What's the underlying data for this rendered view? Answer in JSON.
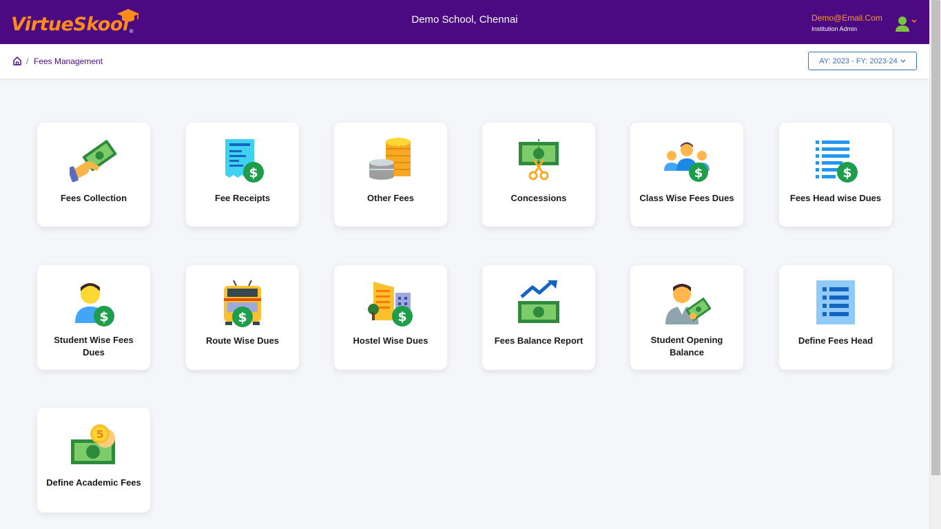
{
  "header": {
    "logo_text": "VirtueSkool",
    "logo_mark": "®",
    "school_name": "Demo School, Chennai",
    "user_email": "Demo@Email.Com",
    "user_role": "Institution Admin"
  },
  "breadcrumb": {
    "separator": "/",
    "current": "Fees Management"
  },
  "year_selector": {
    "value": "AY: 2023 - FY: 2023-24"
  },
  "tiles": [
    {
      "label": "Fees Collection",
      "icon": "hand-money-icon"
    },
    {
      "label": "Fee Receipts",
      "icon": "receipt-dollar-icon"
    },
    {
      "label": "Other Fees",
      "icon": "coin-stack-icon"
    },
    {
      "label": "Concessions",
      "icon": "money-scissors-icon"
    },
    {
      "label": "Class Wise Fees Dues",
      "icon": "group-dollar-icon"
    },
    {
      "label": "Fees Head wise Dues",
      "icon": "list-dollar-icon"
    },
    {
      "label": "Student Wise Fees Dues",
      "icon": "student-dollar-icon"
    },
    {
      "label": "Route Wise Dues",
      "icon": "bus-dollar-icon"
    },
    {
      "label": "Hostel Wise Dues",
      "icon": "building-dollar-icon"
    },
    {
      "label": "Fees Balance Report",
      "icon": "money-trend-icon"
    },
    {
      "label": "Student Opening Balance",
      "icon": "person-money-icon"
    },
    {
      "label": "Define Fees Head",
      "icon": "document-list-icon"
    },
    {
      "label": "Define Academic Fees",
      "icon": "cash-coins-icon"
    }
  ],
  "colors": {
    "header_bg": "#4b0a82",
    "accent_orange": "#ff8c1a",
    "link_blue": "#3570b8",
    "dollar_green": "#1e9e4a"
  }
}
